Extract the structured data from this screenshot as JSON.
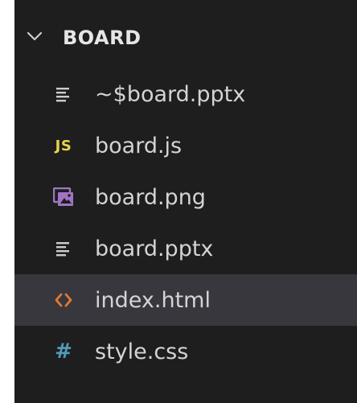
{
  "explorer": {
    "folder": {
      "label": "BOARD",
      "expanded": true,
      "chevron_icon": "chevron-down-icon"
    },
    "files": [
      {
        "name": "~$board.pptx",
        "icon": "text-lines-icon",
        "icon_color": "#cccccc",
        "selected": false
      },
      {
        "name": "board.js",
        "icon": "js-icon",
        "icon_text": "JS",
        "icon_color": "#e8d44d",
        "selected": false
      },
      {
        "name": "board.png",
        "icon": "image-file-icon",
        "icon_color": "#a074c4",
        "selected": false
      },
      {
        "name": "board.pptx",
        "icon": "text-lines-icon",
        "icon_color": "#cccccc",
        "selected": false
      },
      {
        "name": "index.html",
        "icon": "html-brackets-icon",
        "icon_color": "#e37933",
        "selected": true
      },
      {
        "name": "style.css",
        "icon": "hash-icon",
        "icon_text": "#",
        "icon_color": "#519aba",
        "selected": false
      }
    ],
    "colors": {
      "background": "#1e1e1e",
      "text": "#d4d4d4",
      "selection": "#37373d"
    }
  }
}
